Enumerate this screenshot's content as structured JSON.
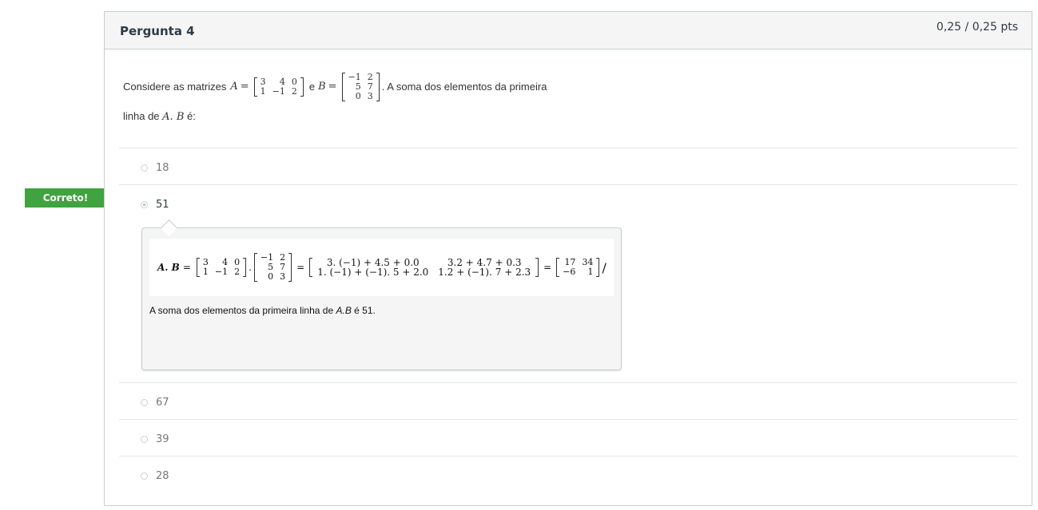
{
  "question": {
    "title": "Pergunta 4",
    "points": "0,25 / 0,25 pts",
    "text_part1": "Considere as matrizes",
    "var_a": "A",
    "eq": "=",
    "matrix_a": [
      [
        "3",
        "4",
        "0"
      ],
      [
        "1",
        "−1",
        "2"
      ]
    ],
    "conj": "e",
    "var_b": "B",
    "matrix_b": [
      [
        "−1",
        "2"
      ],
      [
        "5",
        "7"
      ],
      [
        "0",
        "3"
      ]
    ],
    "text_part2": ". A soma dos elementos da primeira",
    "line2_prefix": "linha de",
    "line2_var": "A. B",
    "line2_suffix": "é:"
  },
  "answers": [
    {
      "label": "18",
      "selected": false
    },
    {
      "label": "51",
      "selected": true
    },
    {
      "label": "67",
      "selected": false
    },
    {
      "label": "39",
      "selected": false
    },
    {
      "label": "28",
      "selected": false
    }
  ],
  "flag": {
    "label": "Correto!",
    "color": "#3fa33f"
  },
  "comment": {
    "lhs": "A. B",
    "product_matrix": [
      [
        "3. (−1) + 4.5 + 0.0",
        "3.2 + 4.7 + 0.3"
      ],
      [
        "1. (−1) + (−1). 5 + 2.0",
        "1.2 + (−1). 7 + 2.3"
      ]
    ],
    "result_matrix": [
      [
        "17",
        "34"
      ],
      [
        "−6",
        "1"
      ]
    ],
    "trailing": "/",
    "text_prefix": "A soma dos elementos da primeira linha de",
    "text_var": "A.B",
    "text_suffix": "é 51."
  }
}
